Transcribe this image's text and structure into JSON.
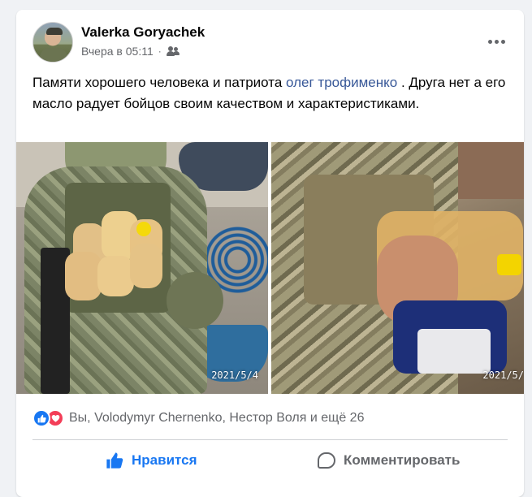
{
  "post": {
    "author": "Valerka Goryachek",
    "time": "Вчера в 05:11",
    "time_sep": "·",
    "audience_icon": "friends-icon",
    "more_icon": "more-options-icon",
    "text_part1": "Памяти хорошего человека и патриота ",
    "mention": "олег трофименко",
    "text_part2": " . Друга нет а его масло радует бойцов своим качеством и характеристиками.",
    "photos": [
      {
        "timestamp": "2021/5/4"
      },
      {
        "timestamp": "2021/5/"
      }
    ]
  },
  "reactions": {
    "icons": [
      "like-reaction-icon",
      "love-reaction-icon"
    ],
    "summary": "Вы, Volodymyr Chernenko, Нестор Воля и ещё 26"
  },
  "actions": {
    "like_label": "Нравится",
    "comment_label": "Комментировать"
  },
  "colors": {
    "accent": "#1877f2",
    "love": "#f33e58",
    "secondary_text": "#65676b",
    "mention": "#385898",
    "background": "#f0f2f5"
  }
}
